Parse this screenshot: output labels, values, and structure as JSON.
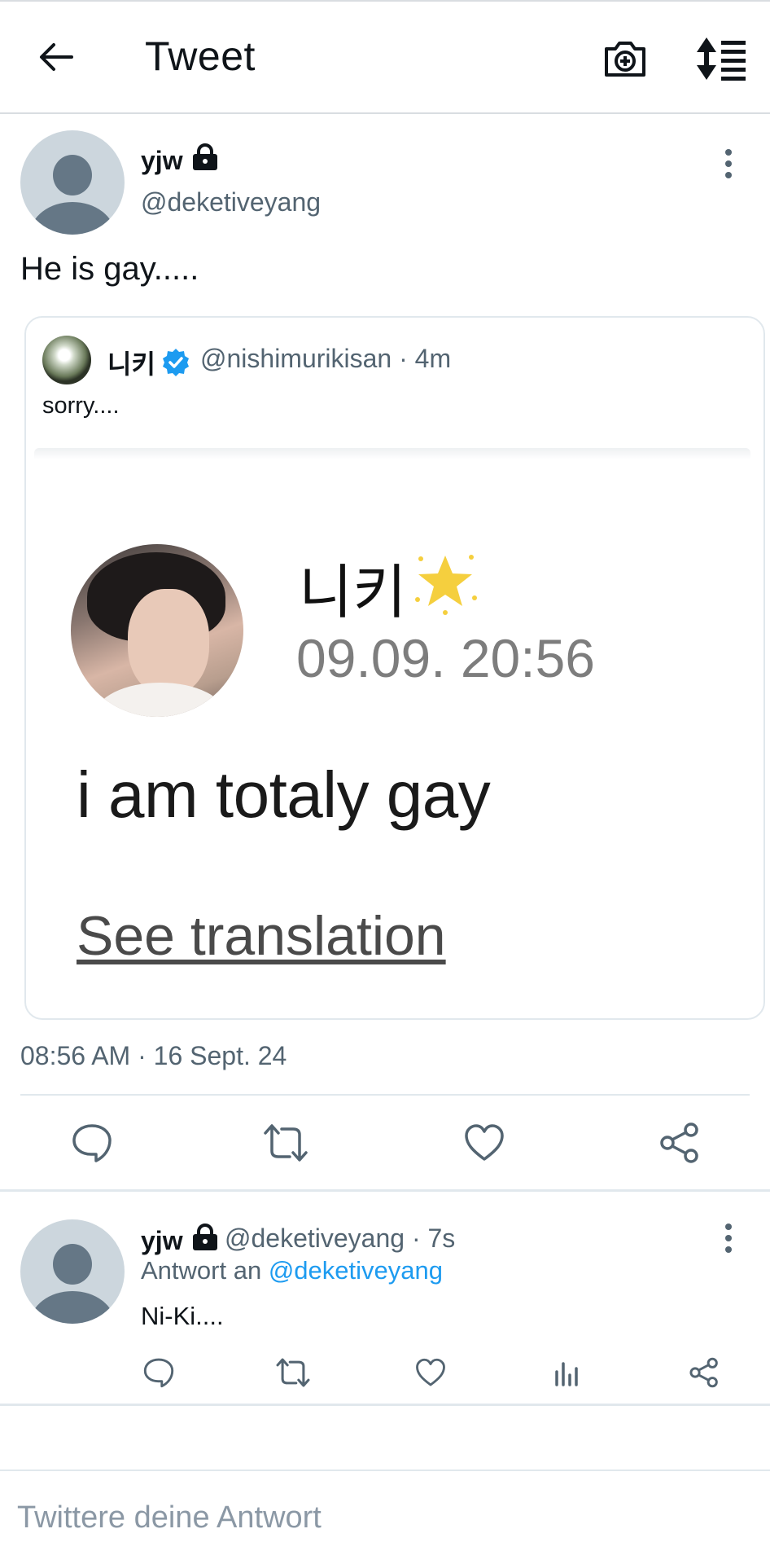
{
  "header": {
    "title": "Tweet",
    "icons": [
      "back-arrow-icon",
      "camera-plus-icon",
      "sort-list-icon"
    ]
  },
  "tweet": {
    "author_name": "yjw",
    "author_handle": "@deketiveyang",
    "text": "He is gay.....",
    "timestamp": "08:56 AM · 16 Sept. 24",
    "quoted": {
      "author_name": "니키",
      "author_handle_meta": "@nishimurikisan · 4m",
      "text": "sorry....",
      "image": {
        "name": "니키",
        "date": "09.09. 20:56",
        "text": "i am totaly gay",
        "link": "See translation"
      }
    }
  },
  "reply": {
    "author_name": "yjw",
    "meta": "@deketiveyang · 7s",
    "reply_to_prefix": "Antwort an",
    "reply_to_mention": "@deketiveyang",
    "text": "Ni-Ki...."
  },
  "composer": {
    "placeholder": "Twittere deine Antwort"
  },
  "colors": {
    "accent": "#1d9bf0",
    "secondary_text": "#536471",
    "avatar_bg": "#ccd6dd",
    "divider": "#e1e8ed"
  }
}
